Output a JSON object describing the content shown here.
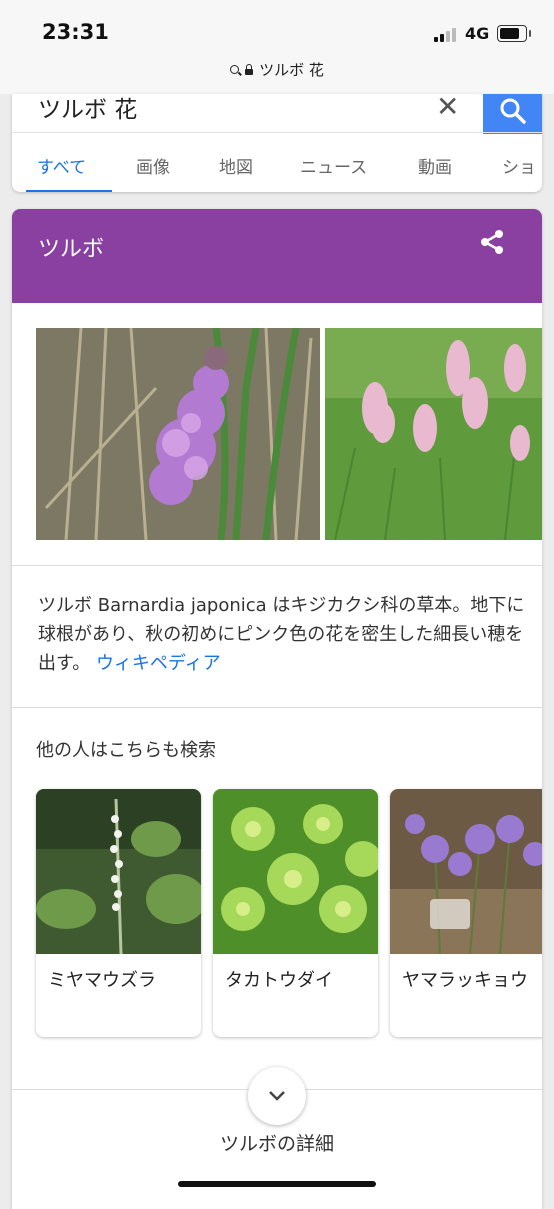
{
  "status_bar": {
    "time": "23:31",
    "network": "4G"
  },
  "browser": {
    "url_text": "ツルボ 花"
  },
  "search": {
    "query": "ツルボ 花",
    "tabs": [
      "すべて",
      "画像",
      "地図",
      "ニュース",
      "動画",
      "ショ"
    ],
    "active_tab": "すべて"
  },
  "knowledge_panel": {
    "title": "ツルボ",
    "description": "ツルボ Barnardia japonica はキジカクシ科の草本。地下に球根があり、秋の初めにピンク色の花を密生した細長い穂を出す。",
    "wiki_link": "ウィキペディア",
    "also_searched_title": "他の人はこちらも検索",
    "related": [
      {
        "label": "ミヤマウズラ"
      },
      {
        "label": "タカトウダイ"
      },
      {
        "label": "ヤマラッキョウ"
      }
    ],
    "more_label": "ツルボの詳細"
  },
  "colors": {
    "header": "#8a40a0",
    "accent": "#1a73e8",
    "search_button": "#4285f4"
  }
}
